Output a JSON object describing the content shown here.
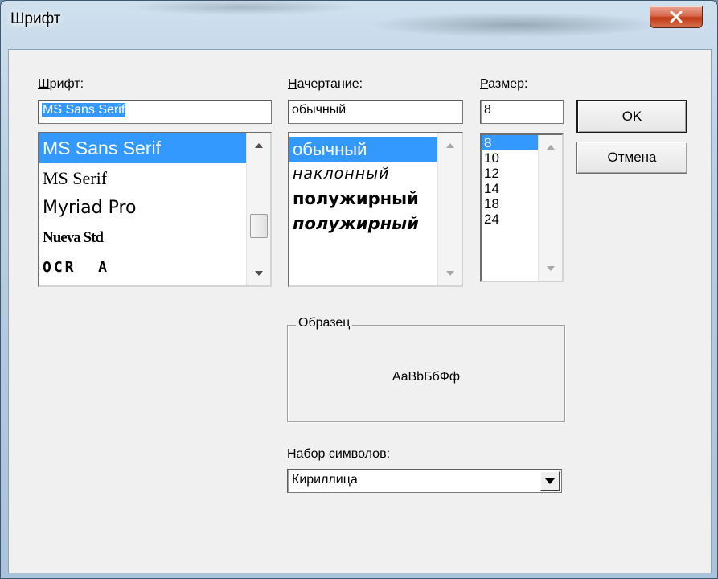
{
  "window": {
    "title": "Шрифт",
    "close_symbol": "x"
  },
  "font": {
    "label": "Шрифт:",
    "value": "MS Sans Serif",
    "items": [
      "MS Sans Serif",
      "MS Serif",
      "Myriad Pro",
      "Nueva Std",
      "OCR  A"
    ],
    "selected_index": 0
  },
  "style": {
    "label": "Начертание:",
    "value": "обычный",
    "items": [
      "обычный",
      "наклонный",
      "полужирный",
      "полужирный"
    ],
    "selected_index": 0
  },
  "size": {
    "label": "Размер:",
    "value": "8",
    "items": [
      "8",
      "10",
      "12",
      "14",
      "18",
      "24"
    ],
    "selected_index": 0
  },
  "buttons": {
    "ok": "OK",
    "cancel": "Отмена"
  },
  "sample": {
    "legend": "Образец",
    "text": "AaBbБбФф"
  },
  "charset": {
    "label": "Набор символов:",
    "value": "Кириллица"
  },
  "colors": {
    "selection": "#3399ff",
    "dialog_bg": "#f0f0f0",
    "close_button": "#c8452a"
  }
}
